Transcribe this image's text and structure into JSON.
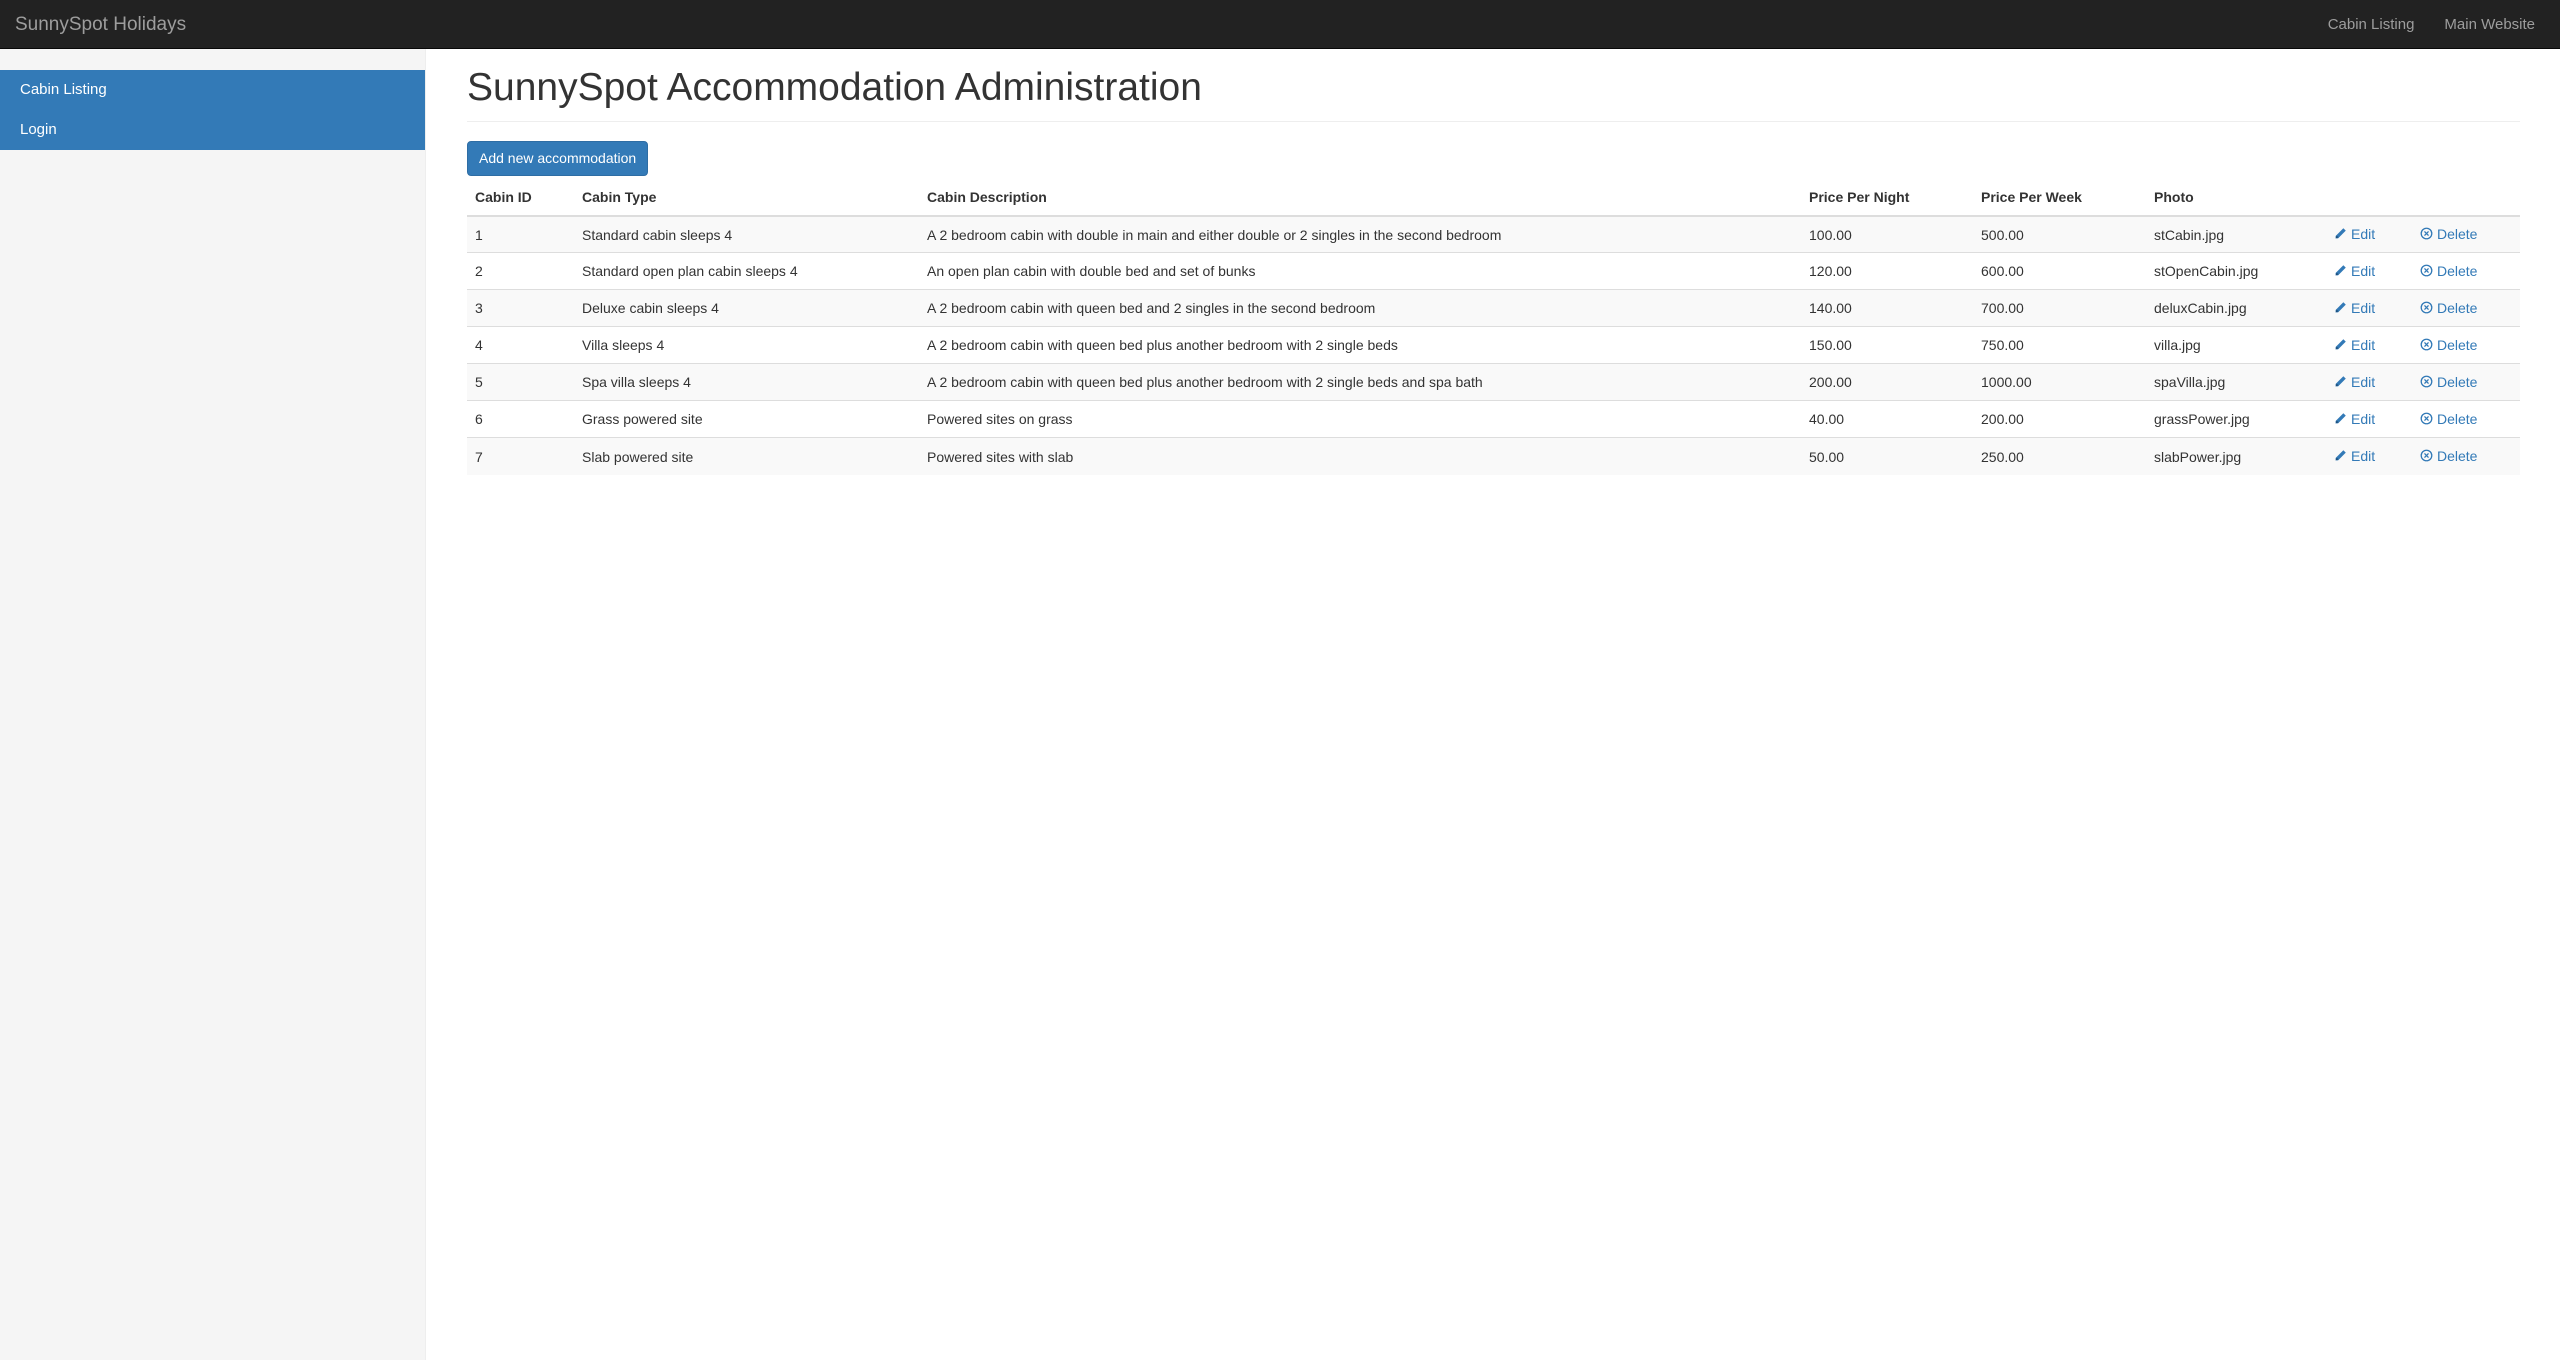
{
  "topbar": {
    "brand": "SunnySpot Holidays",
    "nav": [
      "Cabin Listing",
      "Main Website"
    ]
  },
  "sidebar": {
    "items": [
      {
        "label": "Cabin Listing"
      },
      {
        "label": "Login"
      }
    ]
  },
  "main": {
    "title": "SunnySpot Accommodation Administration",
    "add_button": "Add new accommodation",
    "table": {
      "headers": [
        "Cabin ID",
        "Cabin Type",
        "Cabin Description",
        "Price Per Night",
        "Price Per Week",
        "Photo"
      ],
      "edit_label": "Edit",
      "delete_label": "Delete",
      "rows": [
        [
          "1",
          "Standard cabin sleeps 4",
          "A 2 bedroom cabin with double in main and either double or 2 singles in the second bedroom",
          "100.00",
          "500.00",
          "stCabin.jpg"
        ],
        [
          "2",
          "Standard open plan cabin sleeps 4",
          "An open plan cabin with double bed and set of bunks",
          "120.00",
          "600.00",
          "stOpenCabin.jpg"
        ],
        [
          "3",
          "Deluxe cabin sleeps 4",
          "A 2 bedroom cabin with queen bed and 2 singles in the second bedroom",
          "140.00",
          "700.00",
          "deluxCabin.jpg"
        ],
        [
          "4",
          "Villa sleeps 4",
          "A 2 bedroom cabin with queen bed plus another bedroom with 2 single beds",
          "150.00",
          "750.00",
          "villa.jpg"
        ],
        [
          "5",
          "Spa villa sleeps 4",
          "A 2 bedroom cabin with queen bed plus another bedroom with 2 single beds and spa bath",
          "200.00",
          "1000.00",
          "spaVilla.jpg"
        ],
        [
          "6",
          "Grass powered site",
          "Powered sites on grass",
          "40.00",
          "200.00",
          "grassPower.jpg"
        ],
        [
          "7",
          "Slab powered site",
          "Powered sites with slab",
          "50.00",
          "250.00",
          "slabPower.jpg"
        ]
      ]
    }
  },
  "colors": {
    "navbar": "#222222",
    "primary": "#337ab7",
    "sidebar_bg": "#f5f5f5"
  },
  "icons": {
    "edit": "pencil-icon",
    "delete": "remove-circle-icon"
  }
}
